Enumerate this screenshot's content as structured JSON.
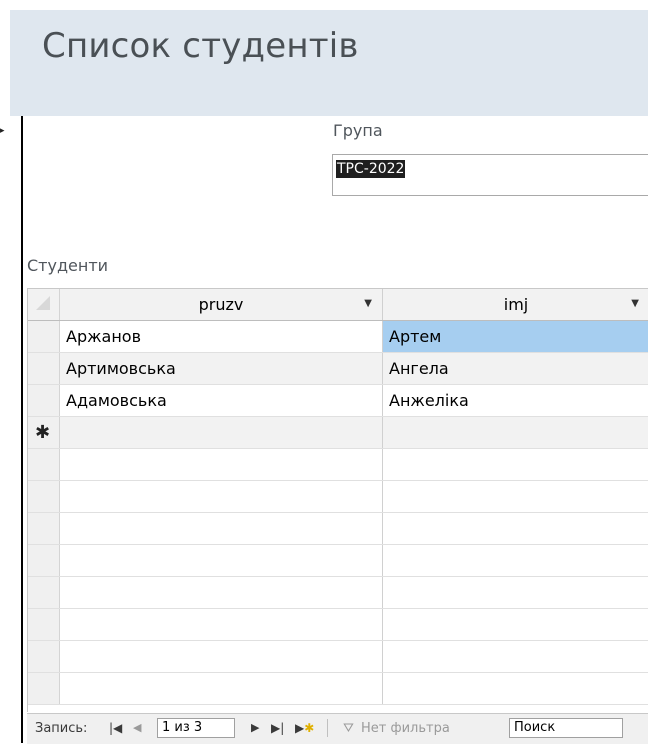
{
  "form": {
    "title": "Список студентів"
  },
  "group": {
    "label": "Група",
    "value": "ТРС-2022"
  },
  "subform": {
    "label": "Студенти",
    "columns": [
      "pruzv",
      "imj"
    ],
    "rows": [
      [
        "Аржанов",
        "Артем"
      ],
      [
        "Артимовська",
        "Ангела"
      ],
      [
        "Адамовська",
        "Анжеліка"
      ]
    ],
    "new_record_symbol": "✱"
  },
  "navigation": {
    "record_label": "Запись:",
    "first_icon": "first-record-icon",
    "prev_icon": "prev-record-icon",
    "current": "1 из 3",
    "next_icon": "next-record-icon",
    "last_icon": "last-record-icon",
    "new_icon": "new-record-icon",
    "filter_label": "Нет фильтра",
    "search_label": "Поиск"
  },
  "colors": {
    "header_bg": "#dfe7ef",
    "selection": "#a6cef0",
    "alt_row": "#f2f2f2"
  }
}
